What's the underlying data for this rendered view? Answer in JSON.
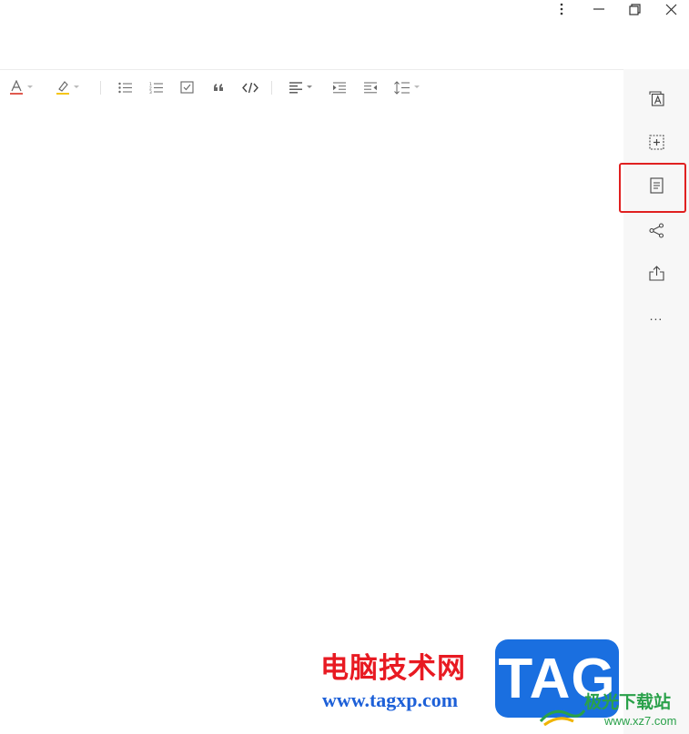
{
  "window": {
    "more_icon": "vertical-ellipsis-icon",
    "minimize_icon": "minimize-icon",
    "restore_icon": "restore-icon",
    "close_icon": "close-icon"
  },
  "toolbar": {
    "items": [
      "font-color",
      "highlight",
      "bullet-list",
      "numbered-list",
      "checklist",
      "quote",
      "code",
      "align",
      "indent",
      "outdent",
      "line-spacing"
    ],
    "accent_font_color": "#e05a4f",
    "accent_highlight": "#f5c518"
  },
  "sidebar": {
    "items": [
      "text-style-icon",
      "insert-block-icon",
      "document-outline-icon",
      "share-icon",
      "export-icon",
      "more-icon"
    ],
    "more_label": "...",
    "highlighted_item": "document-outline-icon",
    "highlight_color": "#e02020"
  },
  "watermark": {
    "chinese_title": "电脑技术网",
    "url": "www.tagxp.com",
    "logo": "TAG",
    "download_site_cn": "极光下载站",
    "download_site_url": "www.xz7.com"
  }
}
